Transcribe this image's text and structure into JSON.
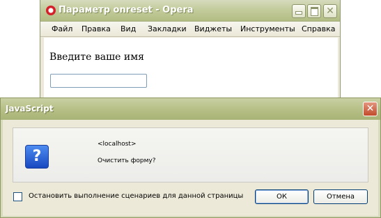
{
  "browser": {
    "title": "Параметр onreset - Opera",
    "menu": [
      "Файл",
      "Правка",
      "Вид",
      "Закладки",
      "Виджеты",
      "Инструменты",
      "Справка"
    ],
    "content": {
      "label": "Введите ваше имя",
      "input_value": ""
    }
  },
  "dialog": {
    "title": "JavaScript",
    "origin": "<localhost>",
    "message": "Очистить форму?",
    "checkbox_label": "Остановить выполнение сценариев для данной страницы",
    "checkbox_checked": false,
    "ok_label": "ОК",
    "cancel_label": "Отмена"
  },
  "icons": {
    "browser_logo": "opera-logo-icon",
    "dialog_icon": "question-icon",
    "dialog_icon_glyph": "?",
    "close_glyph": "✕"
  },
  "colors": {
    "titlebar": "#b7c087",
    "dialog_body": "#ece9d8",
    "close_button": "#c24b2b",
    "question_icon": "#1848c0"
  }
}
